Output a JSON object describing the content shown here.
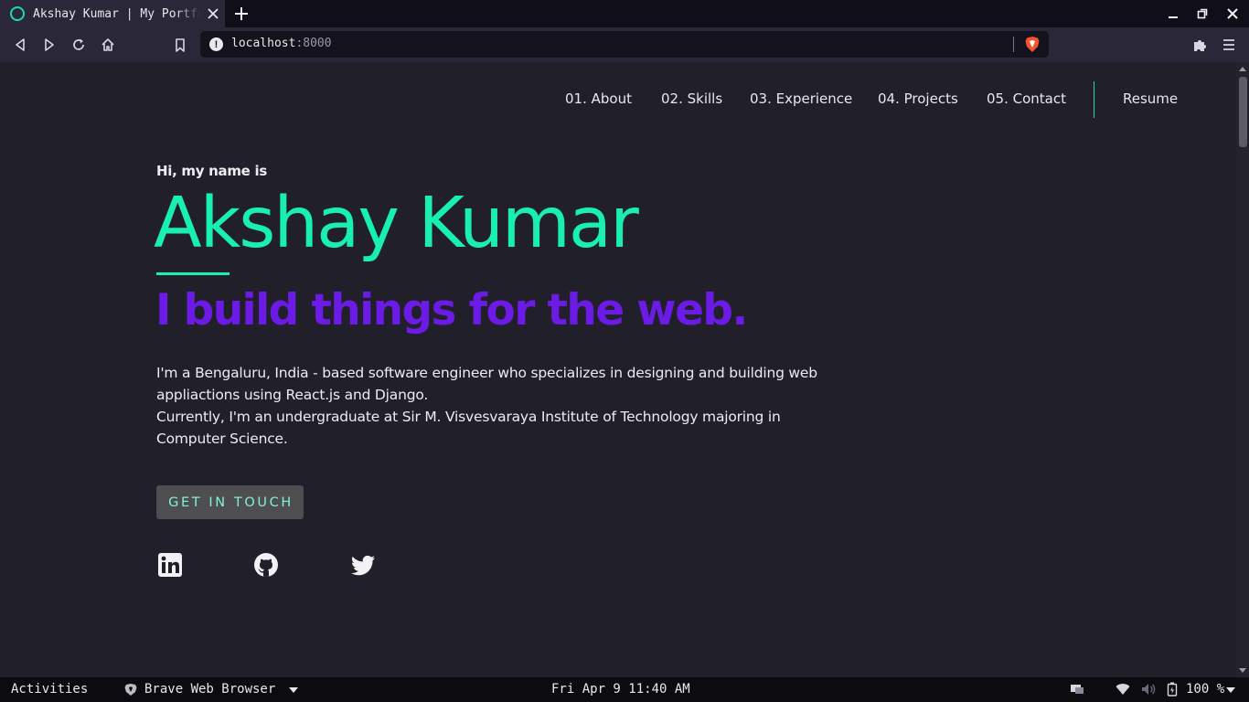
{
  "browser": {
    "tab_title": "Akshay Kumar | My Portfolio",
    "url_host": "localhost",
    "url_port": ":8000",
    "accent_color": "#19d9b6"
  },
  "nav": {
    "items": [
      "01. About",
      "02. Skills",
      "03. Experience",
      "04. Projects",
      "05. Contact"
    ],
    "resume_label": "Resume"
  },
  "hero": {
    "greeting": "Hi, my name is",
    "name": "Akshay Kumar",
    "tagline": "I build things for the web.",
    "bio_lines": [
      "I'm a Bengaluru, India - based software engineer who specializes in designing and building web appliactions using React.js and Django.",
      "Currently, I'm an undergraduate at Sir M. Visvesvaraya Institute of Technology majoring in Computer Science."
    ],
    "cta_label": "GET IN TOUCH",
    "name_color": "#19f0b0",
    "tagline_color": "#6c1be6"
  },
  "social_icons": [
    "linkedin-icon",
    "github-icon",
    "twitter-icon"
  ],
  "taskbar": {
    "activities": "Activities",
    "app_name": "Brave Web Browser",
    "clock": "Fri Apr 9  11:40 AM",
    "battery": "100 %"
  }
}
